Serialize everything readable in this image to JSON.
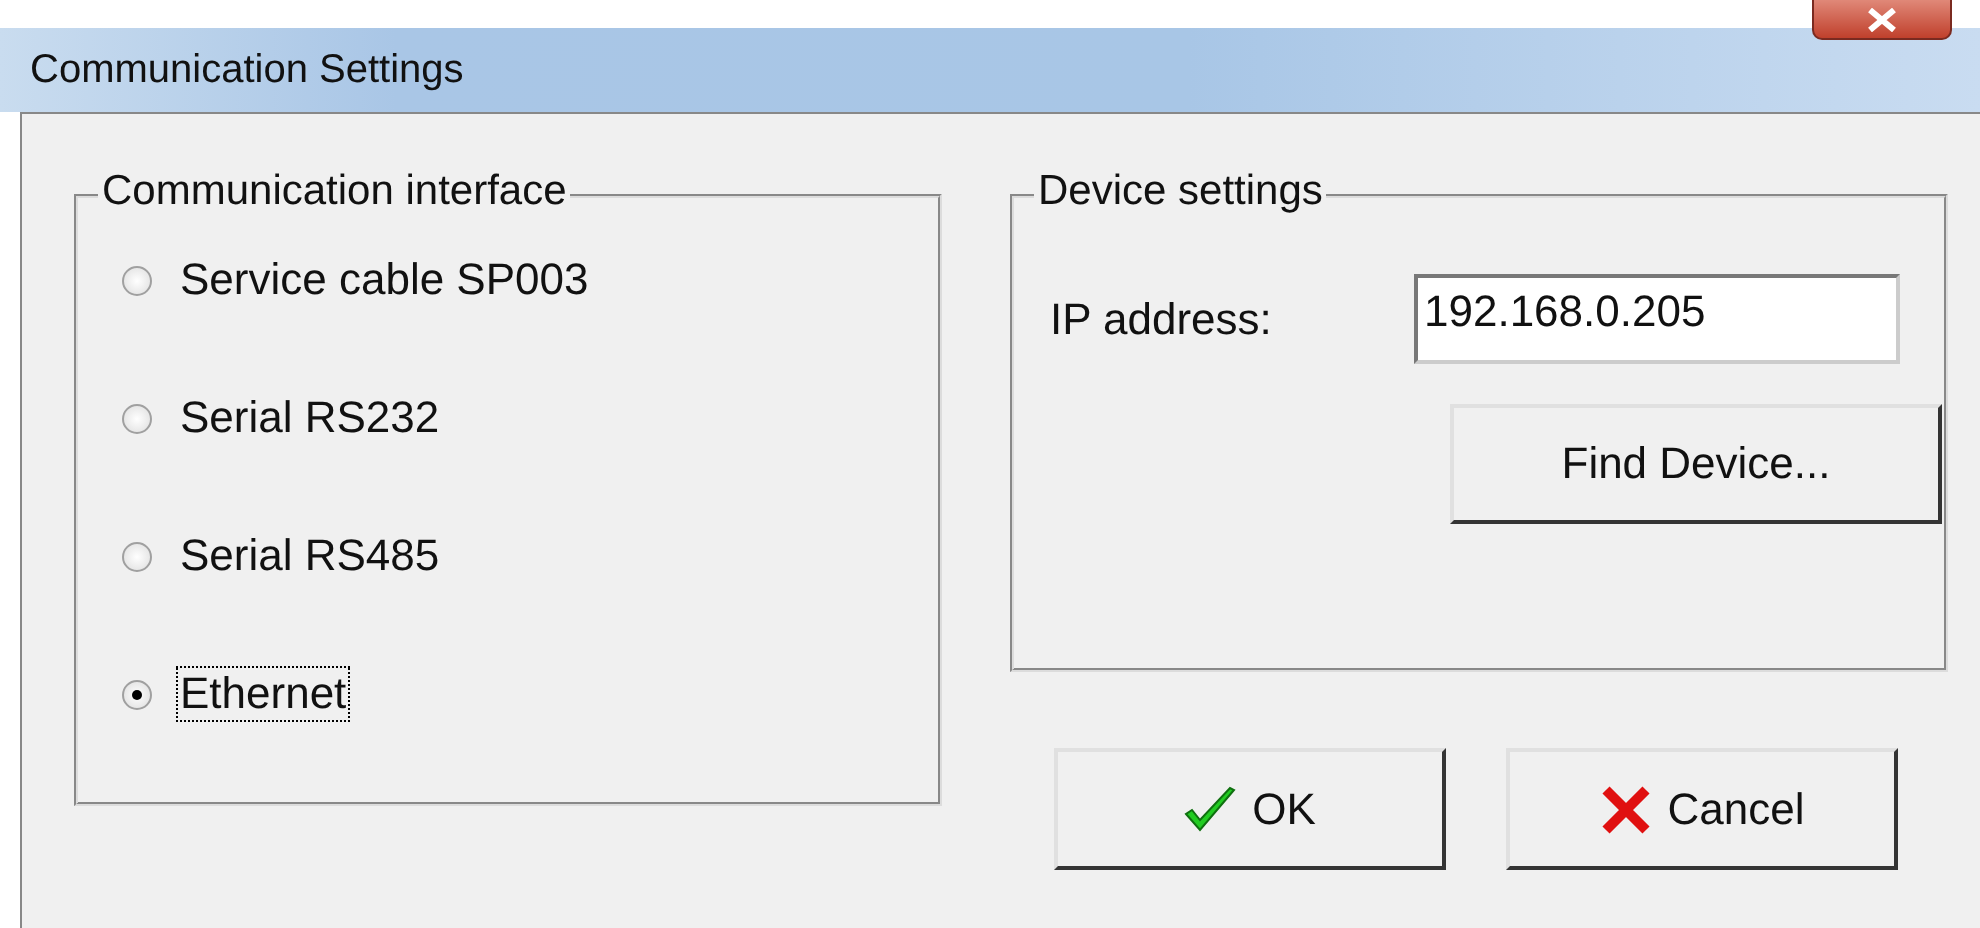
{
  "window": {
    "title": "Communication Settings"
  },
  "interface_group": {
    "legend": "Communication interface",
    "options": [
      {
        "label": "Service cable SP003",
        "selected": false,
        "focused": false
      },
      {
        "label": "Serial RS232",
        "selected": false,
        "focused": false
      },
      {
        "label": "Serial RS485",
        "selected": false,
        "focused": false
      },
      {
        "label": "Ethernet",
        "selected": true,
        "focused": true
      }
    ]
  },
  "device_group": {
    "legend": "Device settings",
    "ip_label": "IP address:",
    "ip_value": "192.168.0.205",
    "find_button": "Find Device..."
  },
  "buttons": [
    {
      "kind": "ok",
      "label": "OK"
    },
    {
      "kind": "cancel",
      "label": "Cancel"
    }
  ]
}
